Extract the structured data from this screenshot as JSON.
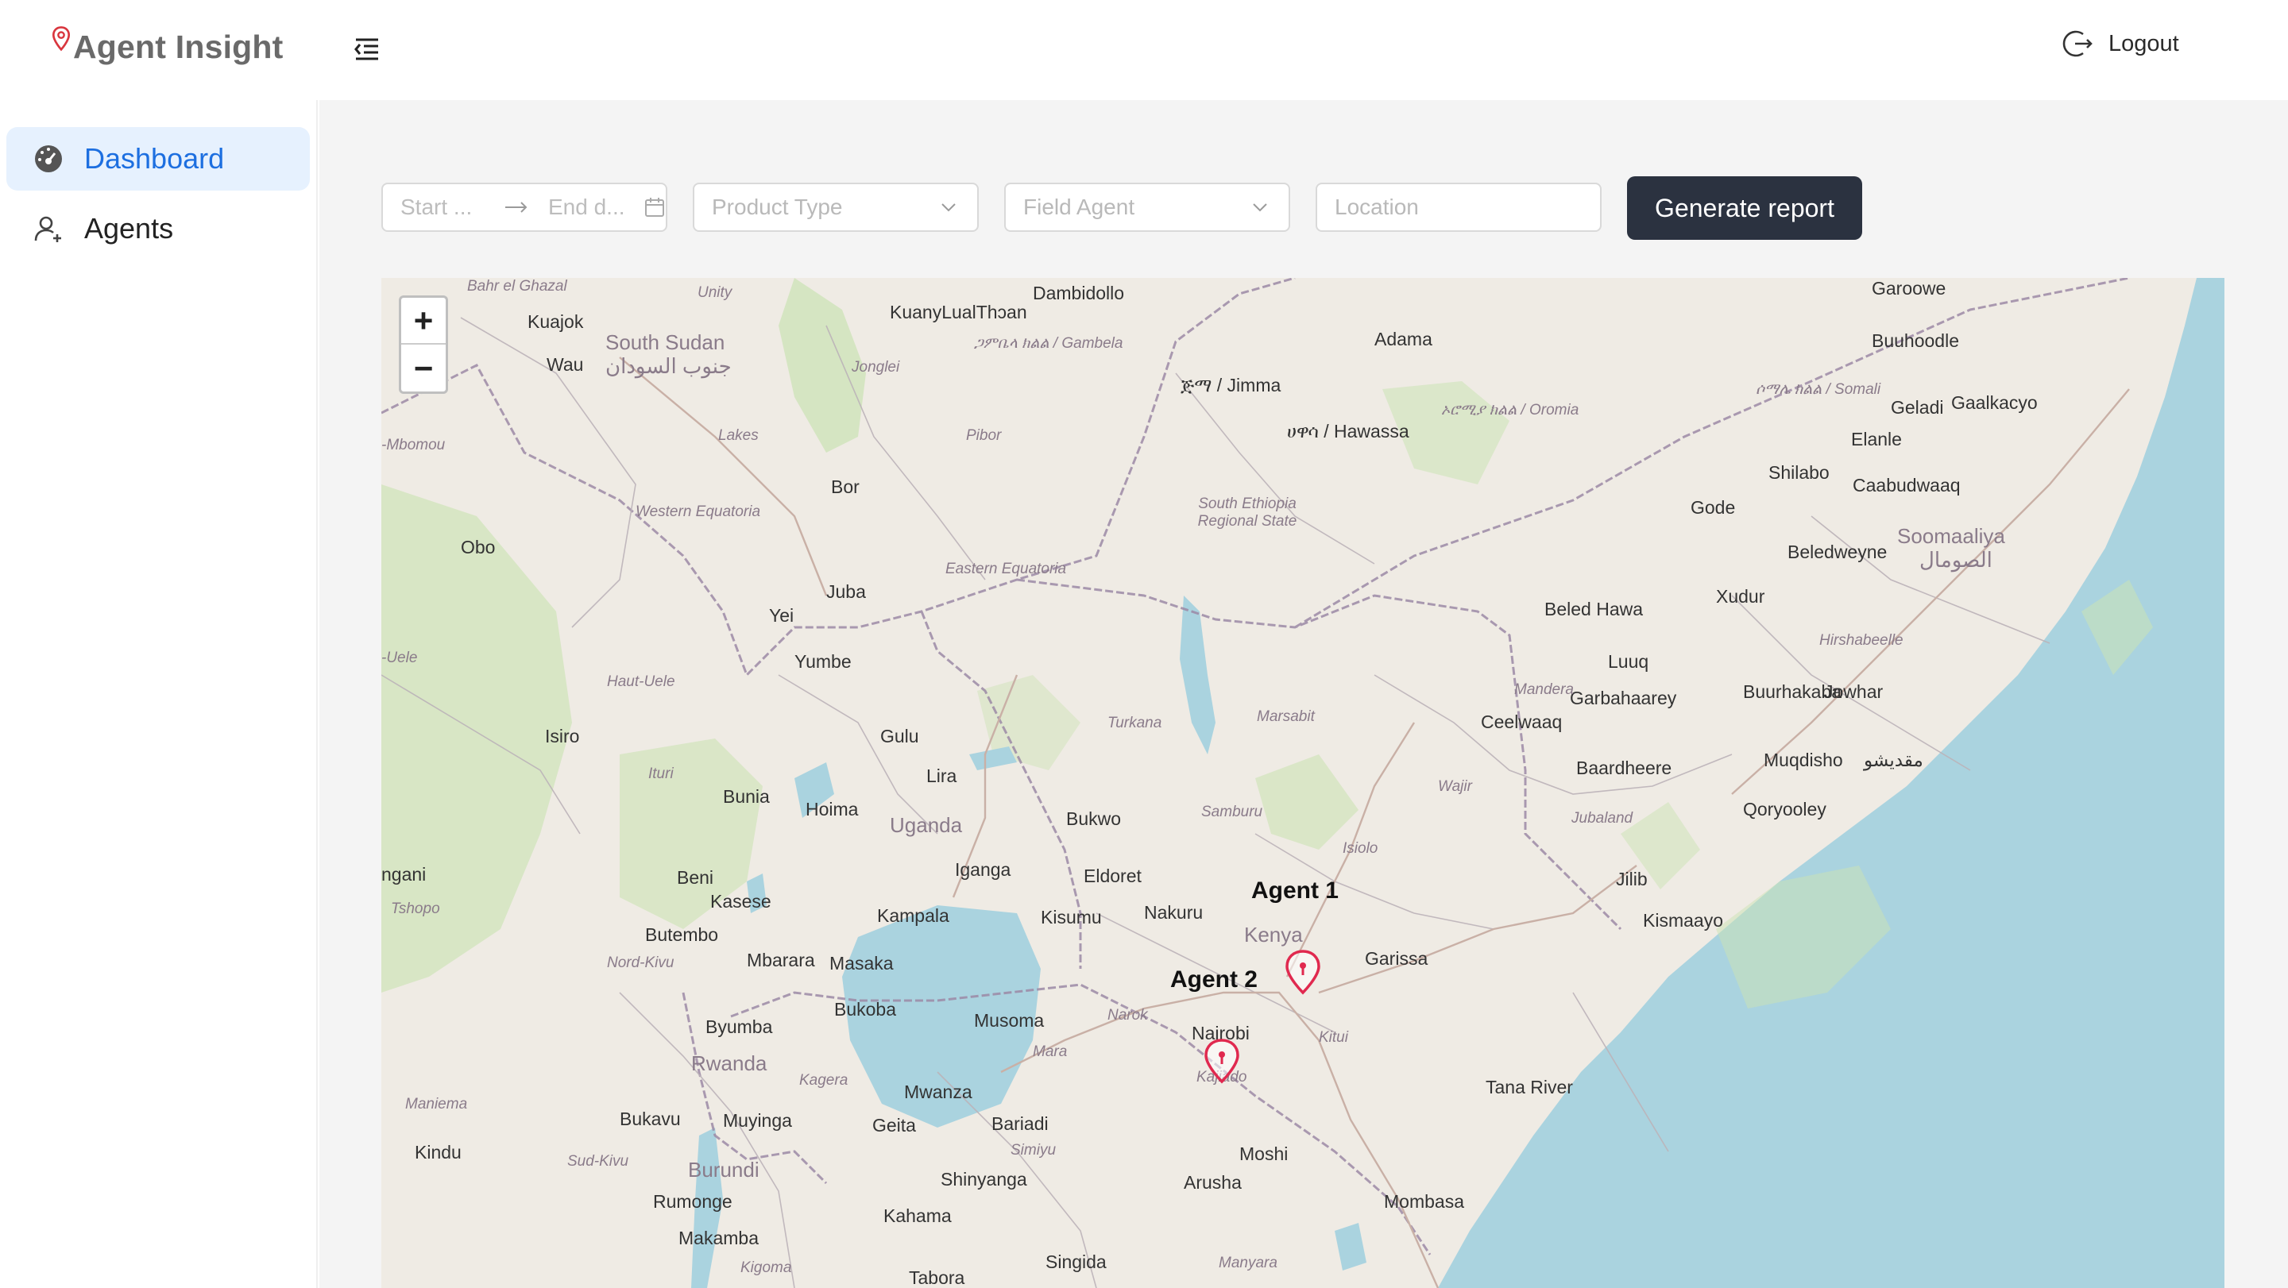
{
  "header": {
    "app_title": "Agent Insight",
    "logout_label": "Logout"
  },
  "sidebar": {
    "items": [
      {
        "label": "Dashboard",
        "icon": "dashboard-icon",
        "active": true
      },
      {
        "label": "Agents",
        "icon": "agents-icon",
        "active": false
      }
    ]
  },
  "filters": {
    "date_start_placeholder": "Start ...",
    "date_end_placeholder": "End d...",
    "product_type_placeholder": "Product Type",
    "field_agent_placeholder": "Field Agent",
    "location_placeholder": "Location",
    "generate_label": "Generate report"
  },
  "map": {
    "zoom_in": "+",
    "zoom_out": "−",
    "markers": [
      {
        "label": "Agent 1"
      },
      {
        "label": "Agent 2"
      }
    ],
    "labels": {
      "south_sudan": "South Sudan",
      "south_sudan_ar": "جنوب السودان",
      "uganda": "Uganda",
      "kenya": "Kenya",
      "rwanda": "Rwanda",
      "burundi": "Burundi",
      "somaaliya": "Soomaaliya",
      "somaaliya_ar": "الصومال",
      "juba": "Juba",
      "kampala": "Kampala",
      "nairobi": "Nairobi",
      "mombasa": "Mombasa",
      "muqdisho": "Muqdisho",
      "muqdisho_ar": "مقديشو",
      "kisumu": "Kisumu",
      "mwanza": "Mwanza",
      "arusha": "Arusha",
      "bunia": "Bunia",
      "gulu": "Gulu",
      "garissa": "Garissa",
      "eldoret": "Eldoret",
      "nakuru": "Nakuru",
      "moshi": "Moshi",
      "kahama": "Kahama",
      "beledweyne": "Beledweyne",
      "gode": "Gode",
      "kismaayo": "Kismaayo",
      "wau": "Wau",
      "yei": "Yei",
      "kuajok": "Kuajok",
      "bor": "Bor",
      "dambidollo": "Dambidollo",
      "adama": "Adama",
      "jimma": "ጅማ / Jimma",
      "hawassa": "ሀዋሳ / Hawassa",
      "garoowe": "Garoowe",
      "buuhoodle": "Buuhoodle",
      "geladi": "Geladi",
      "galkacyo": "Gaalkacyo",
      "elanle": "Elanle",
      "shilabo": "Shilabo",
      "caabudwaaq": "Caabudwaaq",
      "xudur": "Xudur",
      "beled_hawa": "Beled Hawa",
      "luuq": "Luuq",
      "garbahaarey": "Garbahaarey",
      "buurhakaba": "Buurhakaba",
      "jowhar": "Jowhar",
      "ceelwaaq": "Ceelwaaq",
      "baardheere": "Baardheere",
      "qoryooley": "Qoryooley",
      "jilib": "Jilib",
      "mandera": "Mandera",
      "wajir": "Wajir",
      "isiolo": "Isiolo",
      "marsabit": "Marsabit",
      "turkana": "Turkana",
      "samburu": "Samburu",
      "kitui": "Kitui",
      "tana_river": "Tana River",
      "narok": "Narok",
      "kajiado": "Kajiado",
      "bukwo": "Bukwo",
      "iganga": "Iganga",
      "hoima": "Hoima",
      "lira": "Lira",
      "masaka": "Masaka",
      "mbarara": "Mbarara",
      "bukoba": "Bukoba",
      "musoma": "Musoma",
      "mara": "Mara",
      "bariadi": "Bariadi",
      "simiyu": "Simiyu",
      "geita": "Geita",
      "shinyanga": "Shinyanga",
      "singida": "Singida",
      "manyara": "Manyara",
      "tabora": "Tabora",
      "kigoma": "Kigoma",
      "makamba": "Makamba",
      "rumonge": "Rumonge",
      "muyinga": "Muyinga",
      "kagera": "Kagera",
      "bukavu": "Bukavu",
      "kindu": "Kindu",
      "maniema": "Maniema",
      "sud_kivu": "Sud-Kivu",
      "nord_kivu": "Nord-Kivu",
      "butembo": "Butembo",
      "beni": "Beni",
      "kasese": "Kasese",
      "byumba": "Byumba",
      "tshopo": "Tshopo",
      "ituri": "Ituri",
      "isiro": "Isiro",
      "haut_uele": "Haut-Uele",
      "obo": "Obo",
      "yumbe": "Yumbe",
      "western_equatoria": "Western Equatoria",
      "eastern_equatoria": "Eastern Equatoria",
      "lakes": "Lakes",
      "jonglei": "Jonglei",
      "pibor": "Pibor",
      "unity": "Unity",
      "bahr_el_ghazal": "Bahr el Ghazal",
      "gambela": "ጋምቤላ ክልል / Gambela",
      "kuanyluael": "KuanyLualThɔan",
      "oromia": "ኦሮሚያ ክልል / Oromia",
      "somali_region": "ሶማሌ ክልል / Somali",
      "south_ethiopia": "South Ethiopia Regional State",
      "hirshabeelle": "Hirshabeelle",
      "jubaland": "Jubaland",
      "mbomou": "-Mbomou",
      "uele": "-Uele",
      "ngani": "ngani"
    }
  }
}
